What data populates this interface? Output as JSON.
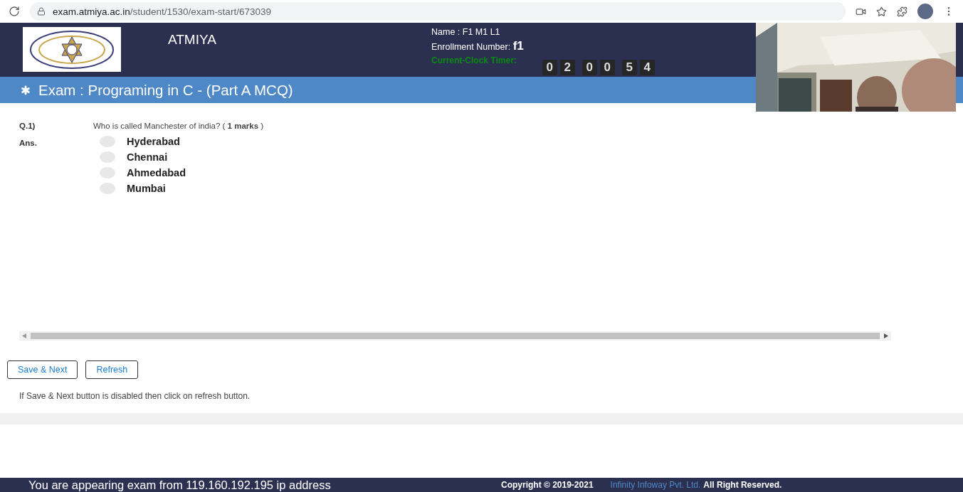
{
  "browser": {
    "url_host": "exam.atmiya.ac.in",
    "url_path": "/student/1530/exam-start/673039"
  },
  "header": {
    "site_name": "ATMIYA",
    "name_label": "Name : F1 M1 L1",
    "enrollment_label": "Enrollment Number:",
    "enrollment_value": "f1",
    "timer_label": "Current-Clock Timer:",
    "timer_digits": [
      "0",
      "2",
      "0",
      "0",
      "5",
      "4"
    ]
  },
  "exam_title": "Exam : Programing in C - (Part A MCQ)",
  "question": {
    "number": "Q.1)",
    "text": "Who is called Manchester of india? ( **1 marks** )",
    "answer_label": "Ans.",
    "options": [
      {
        "label": "Hyderabad",
        "selected": false
      },
      {
        "label": "Chennai",
        "selected": false
      },
      {
        "label": "Ahmedabad",
        "selected": false
      },
      {
        "label": "Mumbai",
        "selected": false
      }
    ]
  },
  "buttons": [
    "Save & Next",
    "Refresh"
  ],
  "note": "If Save & Next button is disabled then click on refresh button.",
  "footer": {
    "ip_text": "You are appearing exam from 119.160.192.195 ip address",
    "copyright": "Copyright © 2019-2021",
    "company": "Infinity Infoway Pvt. Ltd.",
    "rights": "All Right Reserved."
  }
}
